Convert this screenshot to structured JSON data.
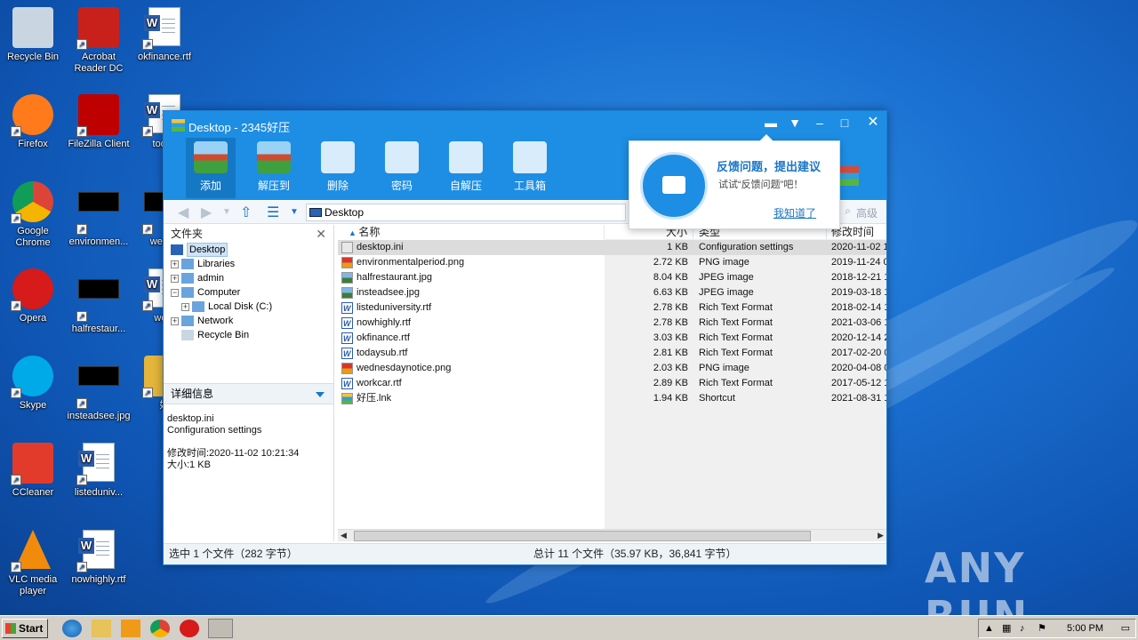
{
  "desktop": {
    "icons": [
      {
        "label": "Recycle Bin",
        "icon": "recycle-bin-icon"
      },
      {
        "label": "Acrobat Reader DC",
        "icon": "acrobat-icon"
      },
      {
        "label": "okfinance.rtf",
        "icon": "word-document-icon"
      },
      {
        "label": "Firefox",
        "icon": "firefox-icon"
      },
      {
        "label": "FileZilla Client",
        "icon": "filezilla-icon"
      },
      {
        "label": "today",
        "icon": "word-document-icon"
      },
      {
        "label": "Google Chrome",
        "icon": "chrome-icon"
      },
      {
        "label": "environmen...",
        "icon": "image-icon"
      },
      {
        "label": "wedne",
        "icon": "image-icon"
      },
      {
        "label": "Opera",
        "icon": "opera-icon"
      },
      {
        "label": "halfrestaur...",
        "icon": "image-icon"
      },
      {
        "label": "work",
        "icon": "word-document-icon"
      },
      {
        "label": "Skype",
        "icon": "skype-icon"
      },
      {
        "label": "insteadsee.jpg",
        "icon": "image-icon"
      },
      {
        "label": "好",
        "icon": "archive-icon"
      },
      {
        "label": "CCleaner",
        "icon": "ccleaner-icon"
      },
      {
        "label": "listeduniv...",
        "icon": "word-document-icon"
      },
      {
        "label": "VLC media player",
        "icon": "vlc-icon"
      },
      {
        "label": "nowhighly.rtf",
        "icon": "word-document-icon"
      }
    ],
    "watermark": "ANY RUN"
  },
  "window": {
    "title": "Desktop - 2345好压",
    "toolbar": [
      {
        "label": "添加",
        "icon": "add-archive-icon"
      },
      {
        "label": "解压到",
        "icon": "extract-to-icon"
      },
      {
        "label": "删除",
        "icon": "delete-icon"
      },
      {
        "label": "密码",
        "icon": "password-lock-icon"
      },
      {
        "label": "自解压",
        "icon": "self-extract-icon"
      },
      {
        "label": "工具箱",
        "icon": "toolbox-icon"
      }
    ],
    "address": "Desktop",
    "advanced": "高级",
    "folders_title": "文件夹",
    "tree": [
      {
        "label": "Desktop",
        "selected": true
      },
      {
        "label": "Libraries"
      },
      {
        "label": "admin"
      },
      {
        "label": "Computer"
      },
      {
        "label": "Local Disk (C:)"
      },
      {
        "label": "Network"
      },
      {
        "label": "Recycle Bin"
      }
    ],
    "details_title": "详细信息",
    "details": {
      "name": "desktop.ini",
      "type": "Configuration settings",
      "modified": "修改时间:2020-11-02 10:21:34",
      "size": "大小:1 KB"
    },
    "columns": {
      "name": "名称",
      "size": "大小",
      "type": "类型",
      "modified": "修改时间"
    },
    "files": [
      {
        "name": "desktop.ini",
        "size": "1 KB",
        "type": "Configuration settings",
        "modified": "2020-11-02 1",
        "kind": "ini"
      },
      {
        "name": "environmentalperiod.png",
        "size": "2.72 KB",
        "type": "PNG image",
        "modified": "2019-11-24 0",
        "kind": "png"
      },
      {
        "name": "halfrestaurant.jpg",
        "size": "8.04 KB",
        "type": "JPEG image",
        "modified": "2018-12-21 1",
        "kind": "jpg"
      },
      {
        "name": "insteadsee.jpg",
        "size": "6.63 KB",
        "type": "JPEG image",
        "modified": "2019-03-18 1",
        "kind": "jpg"
      },
      {
        "name": "listeduniversity.rtf",
        "size": "2.78 KB",
        "type": "Rich Text Format",
        "modified": "2018-02-14 1",
        "kind": "rtf"
      },
      {
        "name": "nowhighly.rtf",
        "size": "2.78 KB",
        "type": "Rich Text Format",
        "modified": "2021-03-06 1",
        "kind": "rtf"
      },
      {
        "name": "okfinance.rtf",
        "size": "3.03 KB",
        "type": "Rich Text Format",
        "modified": "2020-12-14 2",
        "kind": "rtf"
      },
      {
        "name": "todaysub.rtf",
        "size": "2.81 KB",
        "type": "Rich Text Format",
        "modified": "2017-02-20 0",
        "kind": "rtf"
      },
      {
        "name": "wednesdaynotice.png",
        "size": "2.03 KB",
        "type": "PNG image",
        "modified": "2020-04-08 0",
        "kind": "png"
      },
      {
        "name": "workcar.rtf",
        "size": "2.89 KB",
        "type": "Rich Text Format",
        "modified": "2017-05-12 1",
        "kind": "rtf"
      },
      {
        "name": "好压.lnk",
        "size": "1.94 KB",
        "type": "Shortcut",
        "modified": "2021-08-31 1",
        "kind": "lnk"
      }
    ],
    "status_left": "选中 1 个文件（282 字节）",
    "status_center": "总计 11 个文件（35.97 KB，36,841 字节）"
  },
  "popup": {
    "title": "反馈问题，提出建议",
    "subtitle": "试试“反馈问题”吧！",
    "ok": "我知道了"
  },
  "taskbar": {
    "start": "Start",
    "clock": "5:00 PM"
  },
  "colors": {
    "accent": "#1d8ee3",
    "link": "#1a76c8",
    "selection": "#dcdcdc"
  }
}
